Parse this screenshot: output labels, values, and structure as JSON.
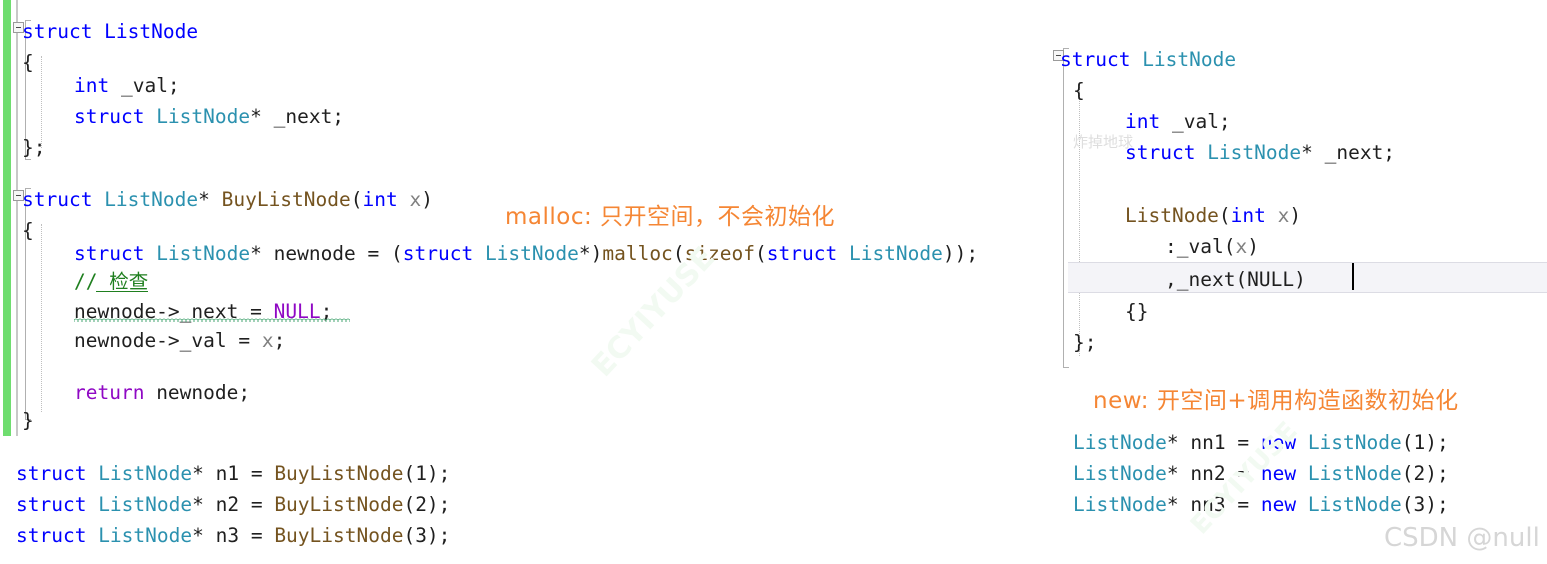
{
  "left_pane": {
    "struct_block": {
      "line1": "struct ListNode",
      "line2": "{",
      "line3_kw": "int",
      "line3_rest": " _val;",
      "line4_kw": "struct",
      "line4_type": " ListNode",
      "line4_rest": "* _next;",
      "line5": "};"
    },
    "function_block": {
      "sig_kw": "struct",
      "sig_type": " ListNode",
      "sig_star": "* ",
      "sig_name": "BuyListNode",
      "sig_paren_open": "(",
      "sig_param_kw": "int",
      "sig_param_name": " x",
      "sig_paren_close": ")",
      "open_brace": "{",
      "malloc_line": {
        "kw1": "struct",
        "type1": " ListNode",
        "mid1": "* newnode = (",
        "kw2": "struct",
        "type2": " ListNode",
        "mid2": "*)",
        "malloc": "malloc",
        "paren1": "(",
        "sizeof": "sizeof",
        "paren2": "(",
        "kw3": "struct",
        "type3": " ListNode",
        "tail": "));"
      },
      "comment": "// 检查",
      "stmt1_a": "newnode->_next = ",
      "stmt1_null": "NULL",
      "stmt1_b": ";",
      "stmt2": "newnode->_val = ",
      "stmt2_var": "x",
      "stmt2_end": ";",
      "return_kw": "return",
      "return_rest": " newnode;",
      "close_brace": "}"
    },
    "usage_lines": [
      {
        "kw": "struct",
        "type": " ListNode",
        "mid": "* n1 = ",
        "fn": "BuyListNode",
        "args": "(1);"
      },
      {
        "kw": "struct",
        "type": " ListNode",
        "mid": "* n2 = ",
        "fn": "BuyListNode",
        "args": "(2);"
      },
      {
        "kw": "struct",
        "type": " ListNode",
        "mid": "* n3 = ",
        "fn": "BuyListNode",
        "args": "(3);"
      }
    ]
  },
  "right_pane": {
    "line1_kw": "struct",
    "line1_type": " ListNode",
    "line2": "{",
    "line3_kw": "int",
    "line3_rest": " _val;",
    "line4_kw": "struct",
    "line4_type": " ListNode",
    "line4_rest": "* _next;",
    "ctor_name": "ListNode",
    "ctor_paren_open": "(",
    "ctor_kw": "int",
    "ctor_param": " x",
    "ctor_paren_close": ")",
    "init1": ":_val(",
    "init1_var": "x",
    "init1_end": ")",
    "init2": ",_next(NULL)",
    "ctor_body": "{}",
    "close": "};",
    "usage_lines": [
      {
        "type": "ListNode",
        "mid": "* nn1 = ",
        "kw": "new",
        "type2": " ListNode",
        "args": "(1);"
      },
      {
        "type": "ListNode",
        "mid": "* nn2 = ",
        "kw": "new",
        "type2": " ListNode",
        "args": "(2);"
      },
      {
        "type": "ListNode",
        "mid": "* nn3 = ",
        "kw": "new",
        "type2": " ListNode",
        "args": "(3);"
      }
    ]
  },
  "annotations": {
    "malloc_note": "malloc: 只开空间，不会初始化",
    "new_note": "new: 开空间+调用构造函数初始化"
  },
  "watermarks": {
    "faint_cn": "炸掉地球",
    "diagonal": "ECYIYUSE",
    "csdn": "CSDN @null"
  },
  "colors": {
    "keyword": "#0000ff",
    "type": "#2b91af",
    "function": "#74531f",
    "control": "#8f08c4",
    "comment": "#1f7f1f",
    "annotation": "#f58634",
    "change_bar": "#6fdd6f",
    "current_line": "#f4f4f8"
  }
}
